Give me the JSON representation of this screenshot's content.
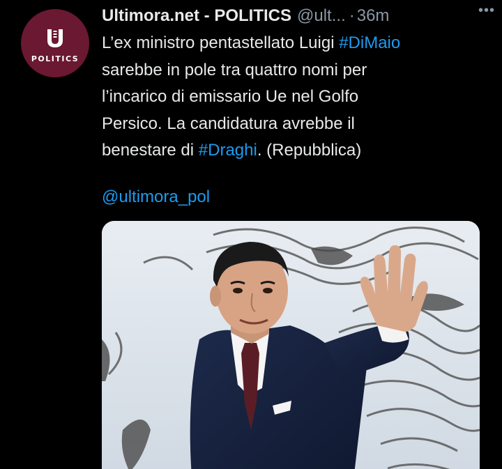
{
  "account": {
    "avatar_label": "POLITICS",
    "display_name": "Ultimora.net - POLITICS",
    "handle": "@ult...",
    "separator": "·",
    "time": "36m"
  },
  "more_icon": "more-horizontal-icon",
  "tweet": {
    "segments": {
      "l1a": "L’ex ministro pentastellato Luigi ",
      "l1tag": "#DiMaio",
      "l2": "sarebbe in pole tra quattro nomi per",
      "l3": "l’incarico di emissario Ue nel Golfo",
      "l4": "Persico. La candidatura avrebbe il",
      "l5a": "benestare di ",
      "l5tag": "#Draghi",
      "l5b": ". (Repubblica)"
    },
    "mention": "@ultimora_pol"
  },
  "media": {
    "description_icon": "photo-man-waving"
  },
  "colors": {
    "background": "#000000",
    "text": "#e7e9ea",
    "muted": "#8b98a5",
    "link": "#1d9bf0",
    "avatar": "#6b1832"
  }
}
